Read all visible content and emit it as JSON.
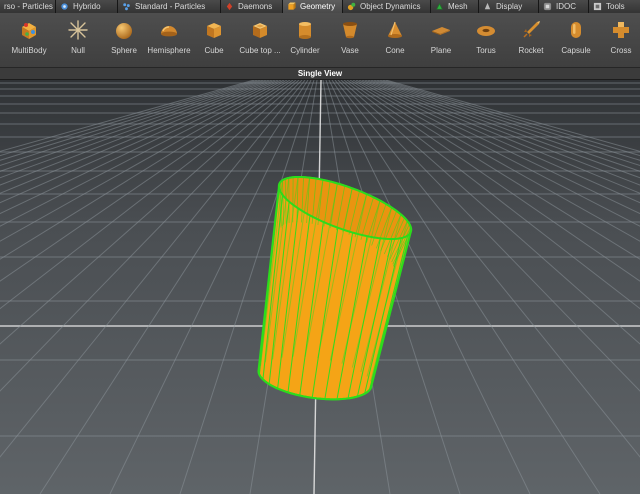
{
  "tabs": [
    {
      "label": "rso - Particles",
      "icon": "particles-icon",
      "active": false
    },
    {
      "label": "Hybrido",
      "icon": "hybrido-icon",
      "active": false
    },
    {
      "label": "Standard - Particles",
      "icon": "standard-particles-icon",
      "active": false
    },
    {
      "label": "Daemons",
      "icon": "daemons-icon",
      "active": false
    },
    {
      "label": "Geometry",
      "icon": "geometry-icon",
      "active": true
    },
    {
      "label": "Object Dynamics",
      "icon": "object-dynamics-icon",
      "active": false
    },
    {
      "label": "Mesh",
      "icon": "mesh-icon",
      "active": false
    },
    {
      "label": "Display",
      "icon": "display-icon",
      "active": false
    },
    {
      "label": "IDOC",
      "icon": "idoc-icon",
      "active": false
    },
    {
      "label": "Tools",
      "icon": "tools-icon",
      "active": false
    }
  ],
  "toolbar": {
    "items": [
      {
        "label": "MultiBody",
        "icon": "multibody-icon"
      },
      {
        "label": "Null",
        "icon": "null-icon"
      },
      {
        "label": "Sphere",
        "icon": "sphere-icon"
      },
      {
        "label": "Hemisphere",
        "icon": "hemisphere-icon"
      },
      {
        "label": "Cube",
        "icon": "cube-icon"
      },
      {
        "label": "Cube top ...",
        "icon": "cube-top-icon"
      },
      {
        "label": "Cylinder",
        "icon": "cylinder-icon"
      },
      {
        "label": "Vase",
        "icon": "vase-icon"
      },
      {
        "label": "Cone",
        "icon": "cone-icon"
      },
      {
        "label": "Plane",
        "icon": "plane-icon"
      },
      {
        "label": "Torus",
        "icon": "torus-icon"
      },
      {
        "label": "Rocket",
        "icon": "rocket-icon"
      },
      {
        "label": "Capsule",
        "icon": "capsule-icon"
      },
      {
        "label": "Cross",
        "icon": "cross-icon"
      }
    ]
  },
  "viewport": {
    "title": "Single View",
    "status_text": "",
    "colors": {
      "object_fill": "#f5a416",
      "object_wire": "#2cdc1c",
      "grid": "#8e969c",
      "axis": "#e4e4e4"
    }
  }
}
